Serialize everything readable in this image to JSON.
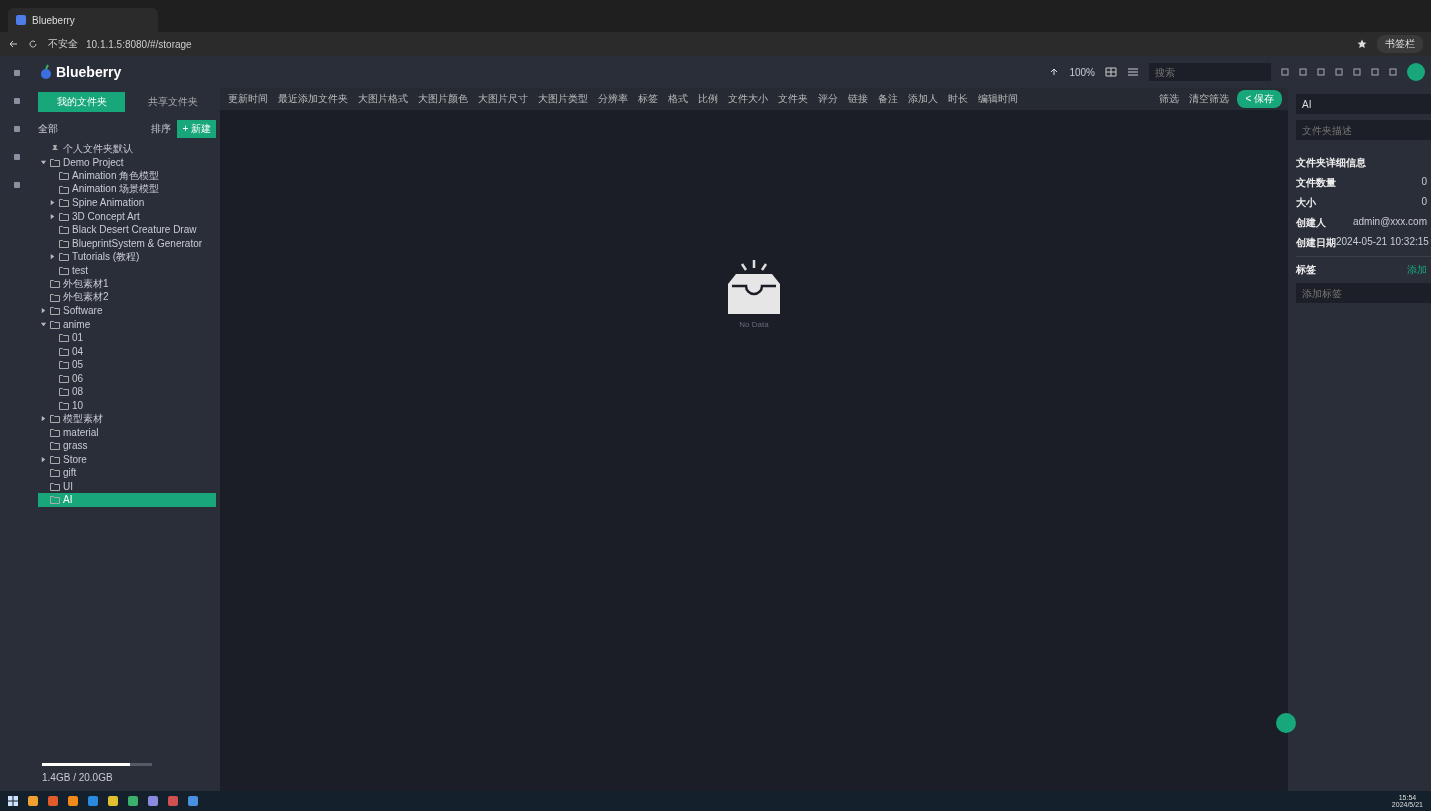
{
  "browser": {
    "tab_title": "Blueberry",
    "address_security": "不安全",
    "address_url": "10.1.1.5:8080/#/storage",
    "bookmark_label": "书签栏"
  },
  "app": {
    "logo": "Blueberry",
    "search": {
      "placeholder": "搜索"
    },
    "zoom_reading": "100%"
  },
  "left_panel": {
    "tabs": [
      {
        "label": "我的文件夹",
        "selected": true
      },
      {
        "label": "共享文件夹",
        "selected": false
      }
    ],
    "all_label": "全部",
    "sort_label": "排序",
    "new_button": "+ 新建",
    "tree": [
      {
        "label": "个人文件夹默认",
        "kind": "pinned",
        "selected": false
      },
      {
        "label": "Demo Project",
        "kind": "folder",
        "expanded": true,
        "selected": false,
        "children": [
          {
            "label": "Animation 角色模型",
            "kind": "folder",
            "selected": false
          },
          {
            "label": "Animation 场景模型",
            "kind": "folder",
            "selected": false
          },
          {
            "label": "Spine Animation",
            "kind": "folder",
            "expanded": false,
            "selected": false
          },
          {
            "label": "3D Concept Art",
            "kind": "folder",
            "expanded": false,
            "selected": false
          },
          {
            "label": "Black Desert Creature Draw",
            "kind": "folder",
            "selected": false
          },
          {
            "label": "BlueprintSystem & Generator",
            "kind": "folder",
            "selected": false
          },
          {
            "label": "Tutorials (教程)",
            "kind": "folder",
            "expanded": false,
            "selected": false
          },
          {
            "label": "test",
            "kind": "folder",
            "selected": false
          }
        ]
      },
      {
        "label": "外包素材1",
        "kind": "folder",
        "selected": false
      },
      {
        "label": "外包素材2",
        "kind": "folder",
        "selected": false
      },
      {
        "label": "Software",
        "kind": "folder",
        "expanded": false,
        "selected": false
      },
      {
        "label": "anime",
        "kind": "folder",
        "expanded": true,
        "selected": false,
        "children": [
          {
            "label": "01",
            "kind": "folder",
            "selected": false
          },
          {
            "label": "04",
            "kind": "folder",
            "selected": false
          },
          {
            "label": "05",
            "kind": "folder",
            "selected": false
          },
          {
            "label": "06",
            "kind": "folder",
            "selected": false
          },
          {
            "label": "08",
            "kind": "folder",
            "selected": false
          },
          {
            "label": "10",
            "kind": "folder",
            "selected": false
          }
        ]
      },
      {
        "label": "模型素材",
        "kind": "folder",
        "expanded": false,
        "selected": false
      },
      {
        "label": "material",
        "kind": "folder",
        "selected": false
      },
      {
        "label": "grass",
        "kind": "folder",
        "selected": false
      },
      {
        "label": "Store",
        "kind": "folder",
        "expanded": false,
        "selected": false
      },
      {
        "label": "gift",
        "kind": "folder",
        "selected": false
      },
      {
        "label": "UI",
        "kind": "folder",
        "selected": false
      },
      {
        "label": "AI",
        "kind": "folder",
        "selected": true
      }
    ],
    "storage": {
      "level": 0.8,
      "reading": "1.4GB / 20.0GB"
    }
  },
  "filters": [
    "更新时间",
    "最近添加文件夹",
    "大图片格式",
    "大图片颜色",
    "大图片尺寸",
    "大图片类型",
    "分辨率",
    "标签",
    "格式",
    "比例",
    "文件大小",
    "文件夹",
    "评分",
    "链接",
    "备注",
    "添加人",
    "时长",
    "编辑时间"
  ],
  "filter_actions": {
    "filter": "筛选",
    "clear": "清空筛选",
    "save": "< 保存"
  },
  "empty_state": {
    "text": "No Data"
  },
  "right_panel": {
    "name_value": "AI",
    "description": {
      "placeholder": "文件夹描述"
    },
    "info_title": "文件夹详细信息",
    "rows": [
      {
        "label": "文件数量",
        "value": "0"
      },
      {
        "label": "大小",
        "value": "0"
      },
      {
        "label": "创建人",
        "value": "admin@xxx.com"
      },
      {
        "label": "创建日期",
        "value": "2024-05-21 10:32:15"
      }
    ],
    "tags_label": "标签",
    "tags_add": "添加",
    "tags_field": {
      "placeholder": "添加标签"
    }
  },
  "taskbar": {
    "time": "15:54",
    "date": "2024/5/21"
  }
}
